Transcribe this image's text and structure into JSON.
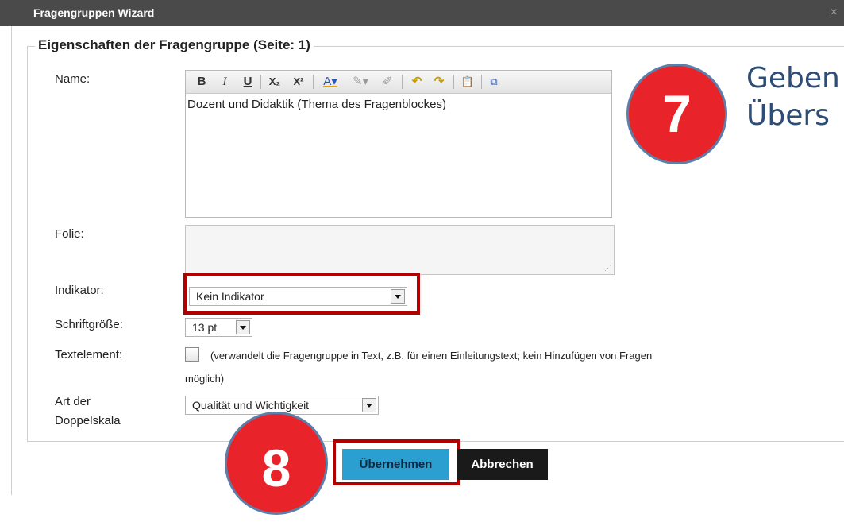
{
  "window": {
    "title": "Fragengruppen Wizard",
    "close_label": "×"
  },
  "fieldset": {
    "legend": "Eigenschaften der Fragengruppe (Seite: 1)"
  },
  "name": {
    "label": "Name:",
    "toolbar": [
      "B",
      "I",
      "U",
      "X₂",
      "X²",
      "A▾",
      "✎▾",
      "✐",
      "↶",
      "↷",
      "📋",
      "⧉"
    ],
    "value": "Dozent und Didaktik (Thema des Fragenblockes)"
  },
  "folie": {
    "label": "Folie:",
    "value": ""
  },
  "indikator": {
    "label": "Indikator:",
    "value": "Kein Indikator"
  },
  "schriftgroesse": {
    "label": "Schriftgröße:",
    "value": "13 pt"
  },
  "textelement": {
    "label": "Textelement:",
    "desc_line1": "(verwandelt die Fragengruppe in Text, z.B. für einen Einleitungstext; kein Hinzufügen von Fragen",
    "desc_line2": "möglich)"
  },
  "doppelskala": {
    "label_line1": "Art der",
    "label_line2": "Doppelskala",
    "value": "Qualität und Wichtigkeit"
  },
  "buttons": {
    "apply": "Übernehmen",
    "cancel": "Abbrechen"
  },
  "callouts": {
    "seven": "7",
    "eight": "8"
  },
  "hint_text": {
    "line1": "Geben",
    "line2": "Übers"
  },
  "colors": {
    "highlight": "#b00000",
    "callout": "#e8232a",
    "primary_button": "#2a9fd0"
  }
}
